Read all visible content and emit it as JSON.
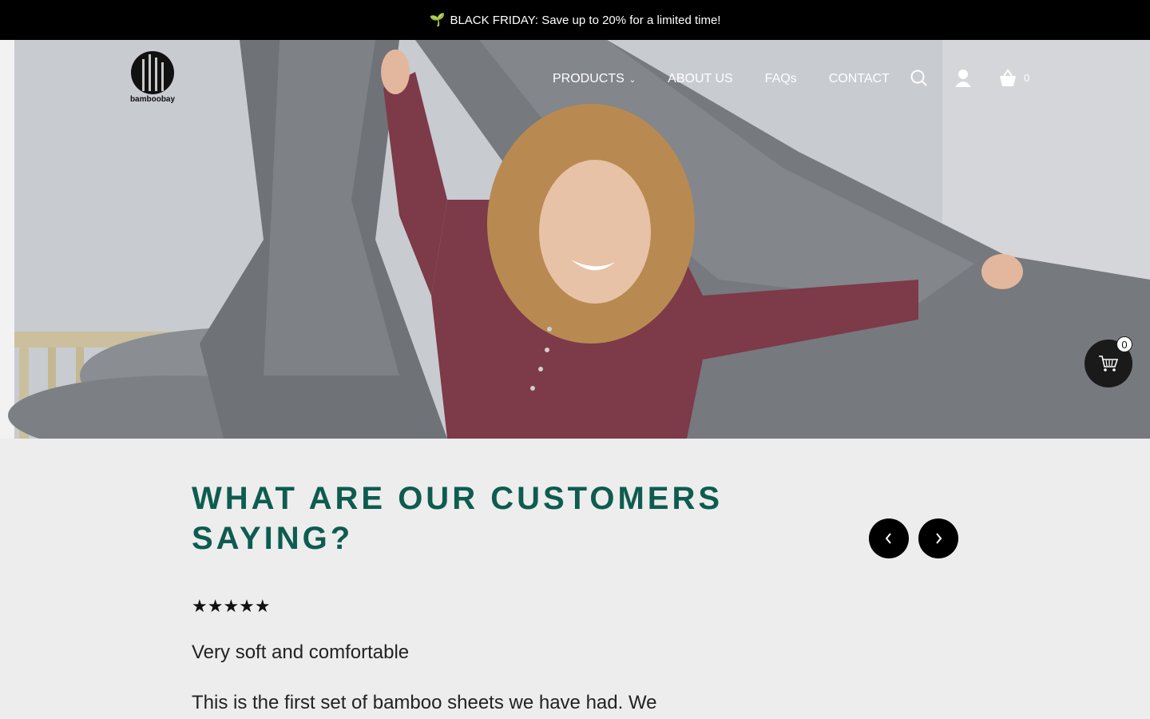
{
  "announcement": {
    "emoji": "🌱",
    "text": "BLACK FRIDAY: Save up to 20% for a limited time!"
  },
  "logo": {
    "text": "bamboobay"
  },
  "nav": {
    "items": [
      {
        "label": "PRODUCTS",
        "has_dropdown": true
      },
      {
        "label": "ABOUT US"
      },
      {
        "label": "FAQs"
      },
      {
        "label": "CONTACT"
      }
    ],
    "cart_count": "0"
  },
  "floating_cart": {
    "count": "0"
  },
  "reviews": {
    "heading": "WHAT ARE OUR CUSTOMERS SAYING?",
    "rating": 5,
    "stars": "★★★★★",
    "review_title": "Very soft and comfortable",
    "review_body": "This is the first set of bamboo sheets we have had. We"
  },
  "colors": {
    "accent": "#0e5c4f",
    "announcement_bg": "#000000"
  }
}
